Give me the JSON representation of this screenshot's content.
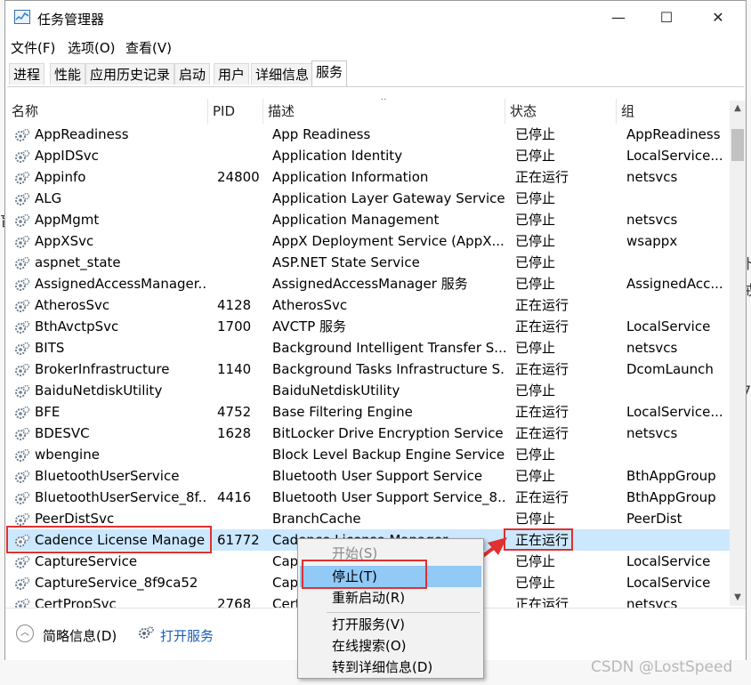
{
  "window": {
    "title": "任务管理器"
  },
  "titlebar": {
    "minimize": "—",
    "maximize": "☐",
    "close": "✕"
  },
  "menu": [
    "文件(F)",
    "选项(O)",
    "查看(V)"
  ],
  "tabs": [
    "进程",
    "性能",
    "应用历史记录",
    "启动",
    "用户",
    "详细信息",
    "服务"
  ],
  "columns": {
    "name": "名称",
    "pid": "PID",
    "desc": "描述",
    "status": "状态",
    "group": "组"
  },
  "rows": [
    {
      "name": "AppReadiness",
      "pid": "",
      "desc": "App Readiness",
      "status": "已停止",
      "group": "AppReadiness"
    },
    {
      "name": "AppIDSvc",
      "pid": "",
      "desc": "Application Identity",
      "status": "已停止",
      "group": "LocalService..."
    },
    {
      "name": "Appinfo",
      "pid": "24800",
      "desc": "Application Information",
      "status": "正在运行",
      "group": "netsvcs"
    },
    {
      "name": "ALG",
      "pid": "",
      "desc": "Application Layer Gateway Service",
      "status": "已停止",
      "group": ""
    },
    {
      "name": "AppMgmt",
      "pid": "",
      "desc": "Application Management",
      "status": "已停止",
      "group": "netsvcs"
    },
    {
      "name": "AppXSvc",
      "pid": "",
      "desc": "AppX Deployment Service (AppX...",
      "status": "已停止",
      "group": "wsappx"
    },
    {
      "name": "aspnet_state",
      "pid": "",
      "desc": "ASP.NET State Service",
      "status": "已停止",
      "group": ""
    },
    {
      "name": "AssignedAccessManager...",
      "pid": "",
      "desc": "AssignedAccessManager 服务",
      "status": "已停止",
      "group": "AssignedAcc..."
    },
    {
      "name": "AtherosSvc",
      "pid": "4128",
      "desc": "AtherosSvc",
      "status": "正在运行",
      "group": ""
    },
    {
      "name": "BthAvctpSvc",
      "pid": "1700",
      "desc": "AVCTP 服务",
      "status": "正在运行",
      "group": "LocalService"
    },
    {
      "name": "BITS",
      "pid": "",
      "desc": "Background Intelligent Transfer S...",
      "status": "已停止",
      "group": "netsvcs"
    },
    {
      "name": "BrokerInfrastructure",
      "pid": "1140",
      "desc": "Background Tasks Infrastructure S...",
      "status": "正在运行",
      "group": "DcomLaunch"
    },
    {
      "name": "BaiduNetdiskUtility",
      "pid": "",
      "desc": "BaiduNetdiskUtility",
      "status": "已停止",
      "group": ""
    },
    {
      "name": "BFE",
      "pid": "4752",
      "desc": "Base Filtering Engine",
      "status": "正在运行",
      "group": "LocalService..."
    },
    {
      "name": "BDESVC",
      "pid": "1628",
      "desc": "BitLocker Drive Encryption Service",
      "status": "正在运行",
      "group": "netsvcs"
    },
    {
      "name": "wbengine",
      "pid": "",
      "desc": "Block Level Backup Engine Service",
      "status": "已停止",
      "group": ""
    },
    {
      "name": "BluetoothUserService",
      "pid": "",
      "desc": "Bluetooth User Support Service",
      "status": "已停止",
      "group": "BthAppGroup"
    },
    {
      "name": "BluetoothUserService_8f...",
      "pid": "4416",
      "desc": "Bluetooth User Support Service_8...",
      "status": "正在运行",
      "group": "BthAppGroup"
    },
    {
      "name": "PeerDistSvc",
      "pid": "",
      "desc": "BranchCache",
      "status": "已停止",
      "group": "PeerDist"
    },
    {
      "name": "Cadence License Manager",
      "pid": "61772",
      "desc": "Cadence License Manager",
      "status": "正在运行",
      "group": "",
      "selected": true
    },
    {
      "name": "CaptureService",
      "pid": "",
      "desc": "Capt",
      "status": "已停止",
      "group": "LocalService"
    },
    {
      "name": "CaptureService_8f9ca52",
      "pid": "",
      "desc": "Capt",
      "status": "已停止",
      "group": "LocalService"
    },
    {
      "name": "CertPropSvc",
      "pid": "2768",
      "desc": "Certi",
      "status": "正在运行",
      "group": "netsvcs"
    }
  ],
  "context_menu": {
    "items": [
      {
        "label": "开始(S)",
        "disabled": true
      },
      {
        "label": "停止(T)",
        "hover": true
      },
      {
        "label": "重新启动(R)"
      },
      {
        "label": "打开服务(V)"
      },
      {
        "label": "在线搜索(O)"
      },
      {
        "label": "转到详细信息(D)"
      }
    ]
  },
  "footer": {
    "summary": "简略信息(D)",
    "open_services": "打开服务"
  },
  "watermark": "CSDN @LostSpeed",
  "colors": {
    "selected_row": "#cce8ff",
    "menu_hover": "#91c9f7",
    "highlight": "#e03030",
    "link": "#1a5fb4"
  }
}
